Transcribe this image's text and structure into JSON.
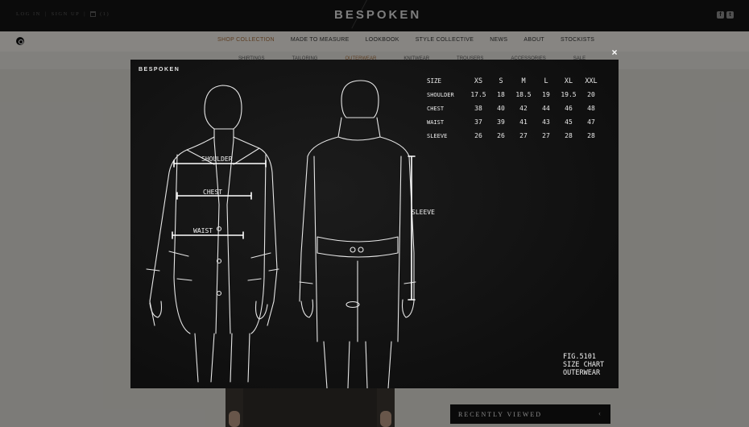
{
  "header": {
    "account_links": [
      "LOG IN",
      "SIGN UP",
      "(1)"
    ],
    "logo": "BESPOKEN",
    "social": [
      "f",
      "t"
    ]
  },
  "nav": {
    "items": [
      "SHOP COLLECTION",
      "MADE TO MEASURE",
      "LOOKBOOK",
      "STYLE COLLECTIVE",
      "NEWS",
      "ABOUT",
      "STOCKISTS"
    ],
    "active": "SHOP COLLECTION"
  },
  "subnav": {
    "items": [
      "SHIRTINGS",
      "TAILORING",
      "OUTERWEAR",
      "KNITWEAR",
      "TROUSERS",
      "ACCESSORIES",
      "SALE"
    ],
    "active": "OUTERWEAR"
  },
  "recently_viewed": {
    "label": "RECENTLY VIEWED",
    "chevron": "‹"
  },
  "modal": {
    "logo": "BESPOKEN",
    "close": "×",
    "size_chart": {
      "header_label": "SIZE",
      "sizes": [
        "XS",
        "S",
        "M",
        "L",
        "XL",
        "XXL"
      ],
      "rows": [
        {
          "label": "SHOULDER",
          "values": [
            "17.5",
            "18",
            "18.5",
            "19",
            "19.5",
            "20"
          ]
        },
        {
          "label": "CHEST",
          "values": [
            "38",
            "40",
            "42",
            "44",
            "46",
            "48"
          ]
        },
        {
          "label": "WAIST",
          "values": [
            "37",
            "39",
            "41",
            "43",
            "45",
            "47"
          ]
        },
        {
          "label": "SLEEVE",
          "values": [
            "26",
            "26",
            "27",
            "27",
            "28",
            "28"
          ]
        }
      ]
    },
    "measurement_labels": {
      "shoulder": "SHOULDER",
      "chest": "CHEST",
      "waist": "WAIST",
      "sleeve": "SLEEVE"
    },
    "caption": {
      "line1": "FIG.5101",
      "line2": "SIZE CHART",
      "line3": "OUTERWEAR"
    }
  },
  "colors": {
    "accent": "#a06a3a",
    "chalkboard": "#121212",
    "chalk": "#f0f0f0"
  },
  "icons": [
    "search-icon",
    "bag-icon",
    "facebook-icon",
    "twitter-icon",
    "close-icon",
    "chevron-left-icon"
  ]
}
